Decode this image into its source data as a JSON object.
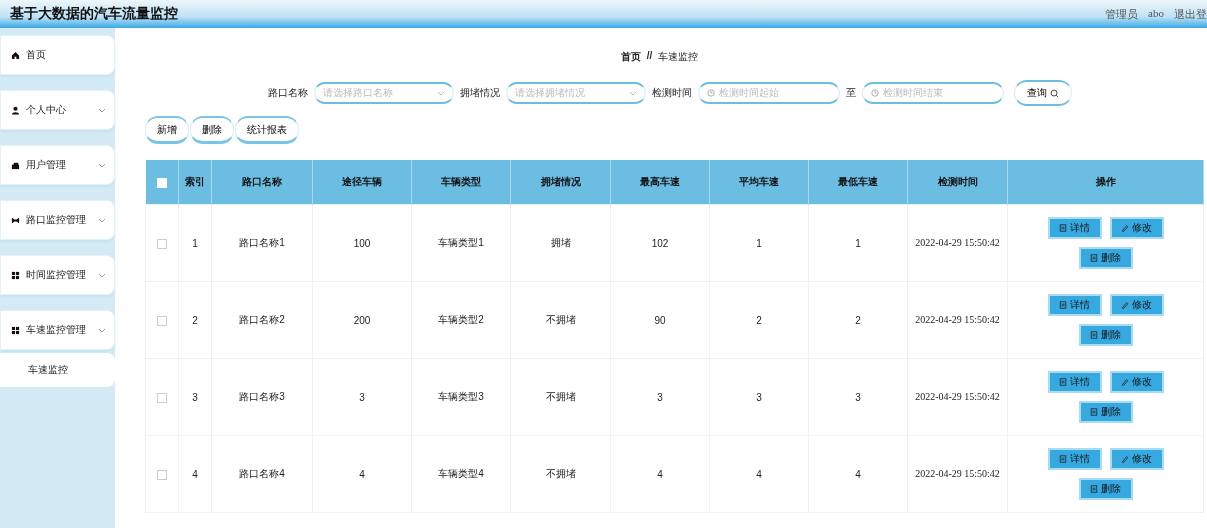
{
  "header": {
    "title": "基于大数据的汽车流量监控",
    "user_role": "管理员",
    "username": "abo",
    "logout": "退出登"
  },
  "sidebar": {
    "items": [
      {
        "label": "首页"
      },
      {
        "label": "个人中心",
        "has_submenu": true
      },
      {
        "label": "用户管理",
        "has_submenu": true
      },
      {
        "label": "路口监控管理",
        "has_submenu": true
      },
      {
        "label": "时间监控管理",
        "has_submenu": true
      },
      {
        "label": "车速监控管理",
        "has_submenu": true,
        "children": [
          {
            "label": "车速监控"
          }
        ]
      }
    ]
  },
  "breadcrumb": {
    "home": "首页",
    "separator": "//",
    "current": "车速监控"
  },
  "filters": [
    {
      "kind": "select",
      "label": "路口名称",
      "placeholder": "请选择路口名称"
    },
    {
      "kind": "select",
      "label": "拥堵情况",
      "placeholder": "请选择拥堵情况"
    },
    {
      "kind": "date",
      "label": "检测时间",
      "placeholder": "检测时间起始"
    },
    {
      "kind": "date",
      "label": "至",
      "placeholder": "检测时间结束"
    }
  ],
  "search_button": "查询",
  "actions": [
    "新增",
    "删除",
    "统计报表"
  ],
  "table": {
    "select_all_checked": false,
    "columns": [
      "索引",
      "路口名称",
      "途径车辆",
      "车辆类型",
      "拥堵情况",
      "最高车速",
      "平均车速",
      "最低车速",
      "检测时间",
      "操作"
    ],
    "rows": [
      {
        "checked": false,
        "cells": [
          "1",
          "路口名称1",
          "100",
          "车辆类型1",
          "拥堵",
          "102",
          "1",
          "1",
          "2022-04-29 15:50:42"
        ],
        "actions": [
          "详情",
          "修改",
          "删除"
        ]
      },
      {
        "checked": false,
        "cells": [
          "2",
          "路口名称2",
          "200",
          "车辆类型2",
          "不拥堵",
          "90",
          "2",
          "2",
          "2022-04-29 15:50:42"
        ],
        "actions": [
          "详情",
          "修改",
          "删除"
        ]
      },
      {
        "checked": false,
        "cells": [
          "3",
          "路口名称3",
          "3",
          "车辆类型3",
          "不拥堵",
          "3",
          "3",
          "3",
          "2022-04-29 15:50:42"
        ],
        "actions": [
          "详情",
          "修改",
          "删除"
        ]
      },
      {
        "checked": false,
        "cells": [
          "4",
          "路口名称4",
          "4",
          "车辆类型4",
          "不拥堵",
          "4",
          "4",
          "4",
          "2022-04-29 15:50:42"
        ],
        "actions": [
          "详情",
          "修改",
          "删除"
        ]
      }
    ]
  }
}
